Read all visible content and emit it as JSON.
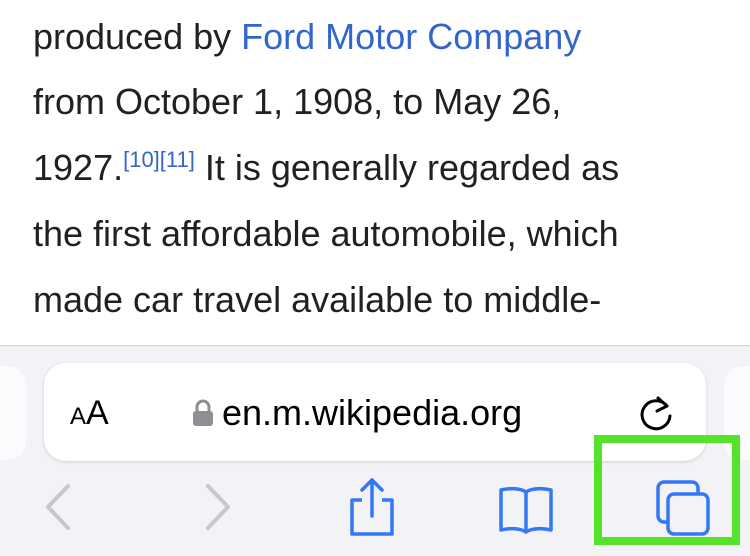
{
  "article": {
    "line1_prefix": "produced by ",
    "line1_link": "Ford Motor Company",
    "line2": "from October 1, 1908, to May 26,",
    "line3_year": "1927.",
    "ref1": "[10]",
    "ref2": "[11]",
    "line3_rest": " It is generally regarded as",
    "line4": "the first affordable automobile, which",
    "line5": "made car travel available to middle-"
  },
  "address_bar": {
    "text_size_label_small": "A",
    "text_size_label_large": "A",
    "url": "en.m.wikipedia.org",
    "lock_icon": "lock-icon",
    "reload_icon": "reload-icon"
  },
  "toolbar": {
    "icons": [
      "back-icon",
      "forward-icon",
      "share-icon",
      "bookmarks-icon",
      "tabs-icon"
    ],
    "highlight_color": "#55e22b",
    "accent_color": "#3478f6",
    "disabled_color": "#c7c7cc"
  }
}
